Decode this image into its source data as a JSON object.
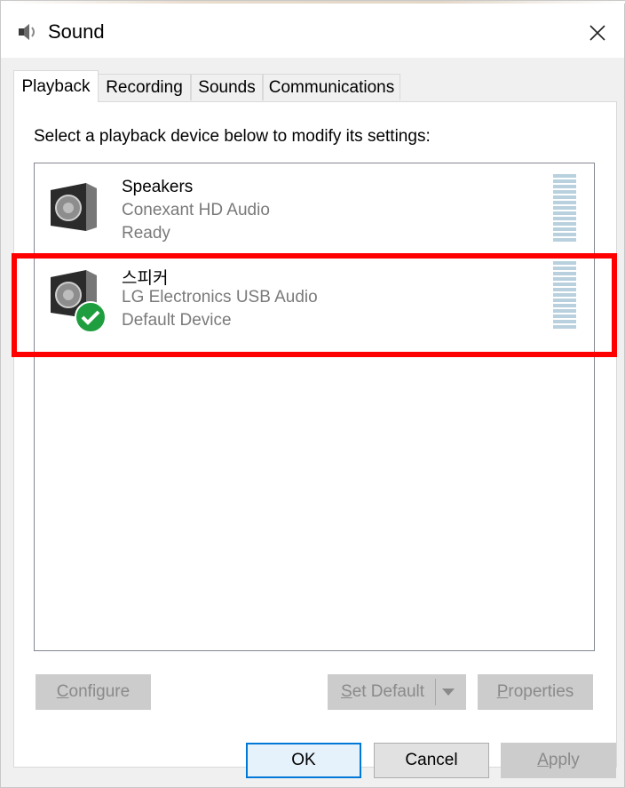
{
  "window": {
    "title": "Sound"
  },
  "tabs": [
    {
      "label": "Playback",
      "active": true
    },
    {
      "label": "Recording",
      "active": false
    },
    {
      "label": "Sounds",
      "active": false
    },
    {
      "label": "Communications",
      "active": false
    }
  ],
  "instructions": "Select a playback device below to modify its settings:",
  "devices": [
    {
      "name": "Speakers",
      "driver": "Conexant HD Audio",
      "status": "Ready",
      "icon": "speaker-icon",
      "default": false
    },
    {
      "name": "스피커",
      "driver": "LG Electronics USB Audio",
      "status": "Default Device",
      "icon": "speaker-icon",
      "default": true
    }
  ],
  "buttons": {
    "configure": {
      "accel": "C",
      "rest": "onfigure"
    },
    "set_default": {
      "accel": "S",
      "rest": "et Default"
    },
    "properties": {
      "accel": "P",
      "rest": "roperties"
    },
    "ok": "OK",
    "cancel": "Cancel",
    "apply": {
      "accel": "A",
      "rest": "pply"
    }
  },
  "colors": {
    "highlight": "#ff0000",
    "default_check": "#1e9e3e",
    "level_meter": "#b9d1de"
  }
}
